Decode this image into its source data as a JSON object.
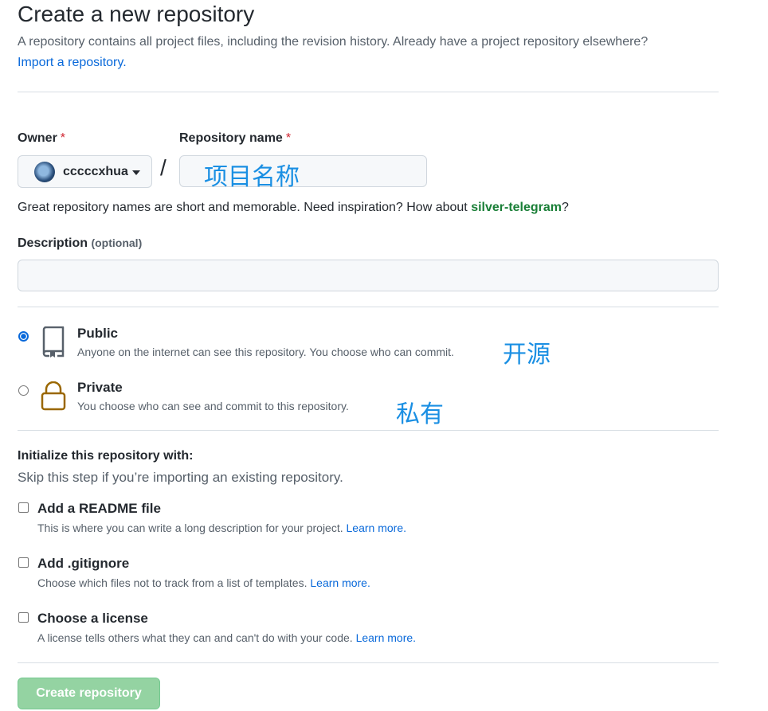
{
  "header": {
    "title": "Create a new repository",
    "subtitle": "A repository contains all project files, including the revision history. Already have a project repository elsewhere?",
    "import_link": "Import a repository."
  },
  "owner": {
    "label": "Owner",
    "required_mark": "*",
    "name": "cccccxhua"
  },
  "repo": {
    "label": "Repository name",
    "required_mark": "*",
    "separator": "/",
    "value": "",
    "annotation": "项目名称"
  },
  "hint": {
    "text": "Great repository names are short and memorable. Need inspiration? How about ",
    "suggestion": "silver-telegram",
    "end": "?"
  },
  "description": {
    "label": "Description",
    "optional": "(optional)",
    "value": ""
  },
  "visibility": {
    "public": {
      "title": "Public",
      "desc": "Anyone on the internet can see this repository. You choose who can commit.",
      "annotation": "开源",
      "selected": true,
      "icon": "repo-icon"
    },
    "private": {
      "title": "Private",
      "desc": "You choose who can see and commit to this repository.",
      "annotation": "私有",
      "selected": false,
      "icon": "lock-icon"
    }
  },
  "initialize": {
    "title": "Initialize this repository with:",
    "subtitle": "Skip this step if you’re importing an existing repository.",
    "readme": {
      "title": "Add a README file",
      "desc": "This is where you can write a long description for your project.",
      "link": "Learn more.",
      "checked": false
    },
    "gitignore": {
      "title": "Add .gitignore",
      "desc": "Choose which files not to track from a list of templates.",
      "link": "Learn more.",
      "checked": false
    },
    "license": {
      "title": "Choose a license",
      "desc": "A license tells others what they can and can't do with your code.",
      "link": "Learn more.",
      "checked": false
    }
  },
  "submit": {
    "label": "Create repository"
  },
  "colors": {
    "link": "#0969da",
    "suggestion": "#1a7f37",
    "required": "#cf222e",
    "annotation": "#1a8fe3",
    "button_disabled": "#94d3a2",
    "lock_icon": "#9a6700"
  }
}
